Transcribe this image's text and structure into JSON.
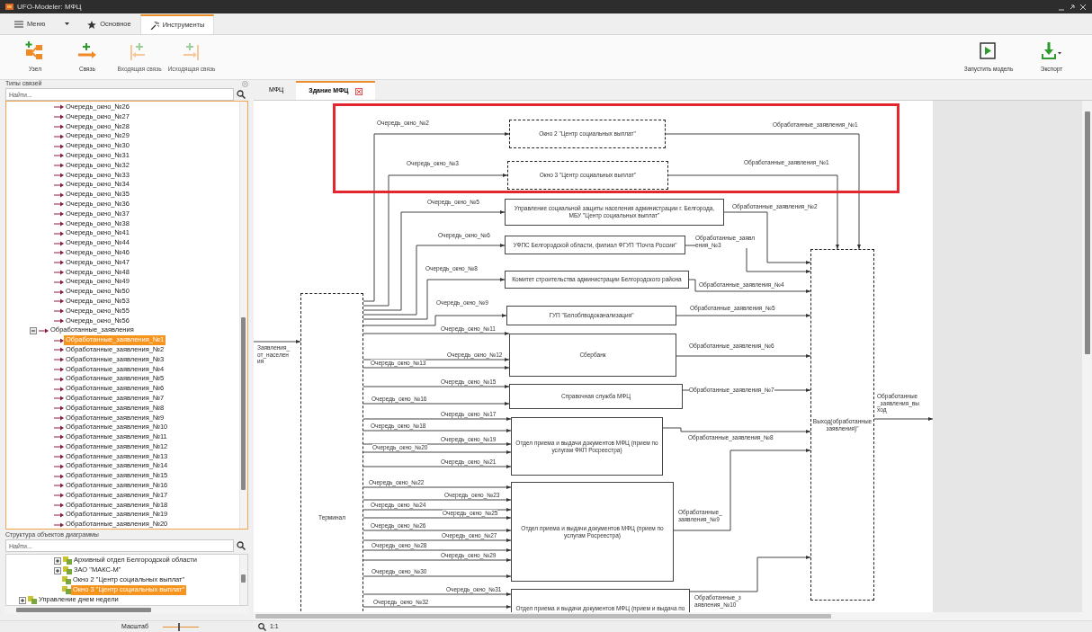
{
  "window": {
    "title": "UFO-Modeler: МФЦ"
  },
  "ribbon_tabs": [
    {
      "label": "Меню",
      "kind": "menu",
      "selected": false
    },
    {
      "label": "Основное",
      "kind": "star",
      "selected": false
    },
    {
      "label": "Инструменты",
      "kind": "tools",
      "selected": true
    }
  ],
  "toolbar": {
    "left": [
      {
        "label": "Узел",
        "kind": "node",
        "disabled": false
      },
      {
        "label": "Связь",
        "kind": "link",
        "disabled": false
      },
      {
        "label": "Входящая связь",
        "kind": "incoming",
        "disabled": true
      },
      {
        "label": "Исходящая связь",
        "kind": "outgoing",
        "disabled": true
      }
    ],
    "right": [
      {
        "label": "Запустить модель",
        "kind": "run"
      },
      {
        "label": "Экспорт",
        "kind": "export"
      }
    ]
  },
  "link_types": {
    "title": "Типы связей",
    "search": {
      "placeholder": "Найти..."
    },
    "items": [
      {
        "label": "Очередь_окно_№26",
        "selected": false
      },
      {
        "label": "Очередь_окно_№27",
        "selected": false
      },
      {
        "label": "Очередь_окно_№28",
        "selected": false
      },
      {
        "label": "Очередь_окно_№29",
        "selected": false
      },
      {
        "label": "Очередь_окно_№30",
        "selected": false
      },
      {
        "label": "Очередь_окно_№31",
        "selected": false
      },
      {
        "label": "Очередь_окно_№32",
        "selected": false
      },
      {
        "label": "Очередь_окно_№33",
        "selected": false
      },
      {
        "label": "Очередь_окно_№34",
        "selected": false
      },
      {
        "label": "Очередь_окно_№35",
        "selected": false
      },
      {
        "label": "Очередь_окно_№36",
        "selected": false
      },
      {
        "label": "Очередь_окно_№37",
        "selected": false
      },
      {
        "label": "Очередь_окно_№38",
        "selected": false
      },
      {
        "label": "Очередь_окно_№41",
        "selected": false
      },
      {
        "label": "Очередь_окно_№44",
        "selected": false
      },
      {
        "label": "Очередь_окно_№46",
        "selected": false
      },
      {
        "label": "Очередь_окно_№47",
        "selected": false
      },
      {
        "label": "Очередь_окно_№48",
        "selected": false
      },
      {
        "label": "Очередь_окно_№49",
        "selected": false
      },
      {
        "label": "Очередь_окно_№50",
        "selected": false
      },
      {
        "label": "Очередь_окно_№53",
        "selected": false
      },
      {
        "label": "Очередь_окно_№55",
        "selected": false
      },
      {
        "label": "Очередь_окно_№56",
        "selected": false
      }
    ],
    "groups": [
      {
        "label": "Обработанные_заявления",
        "expanded": true,
        "selected": false,
        "children": [
          {
            "label": "Обработанные_заявления_№1",
            "selected": true
          },
          {
            "label": "Обработанные_заявления_№2",
            "selected": false
          },
          {
            "label": "Обработанные_заявления_№3",
            "selected": false
          },
          {
            "label": "Обработанные_заявления_№4",
            "selected": false
          },
          {
            "label": "Обработанные_заявления_№5",
            "selected": false
          },
          {
            "label": "Обработанные_заявления_№6",
            "selected": false
          },
          {
            "label": "Обработанные_заявления_№7",
            "selected": false
          },
          {
            "label": "Обработанные_заявления_№8",
            "selected": false
          },
          {
            "label": "Обработанные_заявления_№9",
            "selected": false
          },
          {
            "label": "Обработанные_заявления_№10",
            "selected": false
          },
          {
            "label": "Обработанные_заявления_№11",
            "selected": false
          },
          {
            "label": "Обработанные_заявления_№12",
            "selected": false
          },
          {
            "label": "Обработанные_заявления_№13",
            "selected": false
          },
          {
            "label": "Обработанные_заявления_№14",
            "selected": false
          },
          {
            "label": "Обработанные_заявления_№15",
            "selected": false
          },
          {
            "label": "Обработанные_заявления_№16",
            "selected": false
          },
          {
            "label": "Обработанные_заявления_№17",
            "selected": false
          },
          {
            "label": "Обработанные_заявления_№18",
            "selected": false
          },
          {
            "label": "Обработанные_заявления_№19",
            "selected": false
          },
          {
            "label": "Обработанные_заявления_№20",
            "selected": false
          }
        ]
      }
    ]
  },
  "object_structure": {
    "title": "Структура объектов диаграммы",
    "search": {
      "placeholder": "Найти..."
    },
    "items": [
      {
        "label": "Архивный отдел Белгородской области",
        "expanded": false,
        "selected": false
      },
      {
        "label": "ЗАО \"МАКС-М\"",
        "expanded": false,
        "selected": false
      },
      {
        "label": "Окно 2 \"Центр социальных выплат\"",
        "selected": false
      },
      {
        "label": "Окно 3 \"Центр социальных выплат\"",
        "selected": true
      }
    ],
    "after": [
      {
        "label": "Управление днем недели",
        "expanded": false,
        "selected": false
      }
    ]
  },
  "doc_tabs": [
    {
      "label": "МФЦ",
      "selected": false
    },
    {
      "label": "Здание МФЦ",
      "selected": true
    }
  ],
  "diagram": {
    "highlight_frame": true,
    "nodes": [
      {
        "text": "Окно 2 \"Центр социальных выплат\"",
        "kind": "dashed"
      },
      {
        "text": "Окно 3 \"Центр социальных выплат\"",
        "kind": "dashed"
      },
      {
        "text": "Управление социальной защиты населения администрации г. Белгорода, МБУ \"Центр социальных выплат\"",
        "kind": "solid"
      },
      {
        "text": "УФПС Белгородской области, филиал ФГУП \"Почта России\"",
        "kind": "solid"
      },
      {
        "text": "Комитет строительства администрации Белгородского района",
        "kind": "solid"
      },
      {
        "text": "ГУП \"Белоблводоканализация\"",
        "kind": "solid"
      },
      {
        "text": "Сбербанк",
        "kind": "solid"
      },
      {
        "text": "Справочная служба МФЦ",
        "kind": "solid"
      },
      {
        "text": "Отдел приема и выдачи документов МФЦ (прием по услугам ФКП Росреестра)",
        "kind": "solid"
      },
      {
        "text": "Отдел приема и выдачи документов МФЦ (прием по услугам Росреестра)",
        "kind": "solid"
      },
      {
        "text": "Отдел приема и выдачи документов МФЦ (прием и выдача по",
        "kind": "solid"
      },
      {
        "text": "Терминал",
        "kind": "dashed"
      },
      {
        "text": "Выход(обработанные заявления)\"",
        "kind": "dashed"
      }
    ],
    "input_label": "Заявления_от_населения",
    "queue_labels": [
      "Очередь_окно_№2",
      "Очередь_окно_№3",
      "Очередь_окно_№5",
      "Очередь_окно_№6",
      "Очередь_окно_№8",
      "Очередь_окно_№9",
      "Очередь_окно_№11",
      "Очередь_окно_№12",
      "Очередь_окно_№13",
      "Очередь_окно_№15",
      "Очередь_окно_№16",
      "Очередь_окно_№17",
      "Очередь_окно_№18",
      "Очередь_окно_№19",
      "Очередь_окно_№20",
      "Очередь_окно_№21",
      "Очередь_окно_№22",
      "Очередь_окно_№23",
      "Очередь_окно_№24",
      "Очередь_окно_№25",
      "Очередь_окно_№26",
      "Очередь_окно_№27",
      "Очередь_окно_№28",
      "Очередь_окно_№29",
      "Очередь_окно_№30",
      "Очередь_окно_№31",
      "Очередь_окно_№32"
    ],
    "processed_labels": [
      "Обработанные_заявления_№1",
      "Обработанные_заявления_№1",
      "Обработанные_заявления_№2",
      "Обработанные_заявления_№3",
      "Обработанные_заявления_№4",
      "Обработанные_заявления_№5",
      "Обработанные_заявления_№6",
      "Обработанные_заявления_№7",
      "Обработанные_заявления_№8",
      "Обработанные_заявления_№9",
      "Обработанные_заявления_№10"
    ],
    "output_label": "Обработанные_заявления_выход"
  },
  "status_bar": {
    "zoom_label": "Масштаб",
    "zoom": {
      "level": 0.45
    },
    "scale": "1:1"
  }
}
